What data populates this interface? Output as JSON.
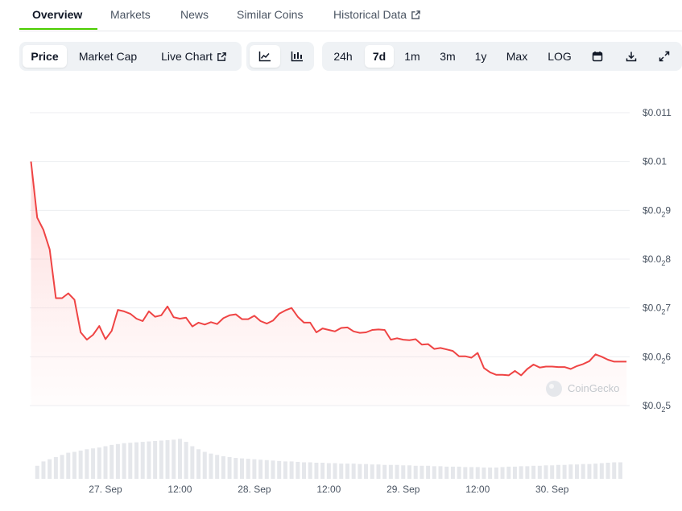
{
  "tabs": [
    {
      "label": "Overview",
      "active": true
    },
    {
      "label": "Markets"
    },
    {
      "label": "News"
    },
    {
      "label": "Similar Coins"
    },
    {
      "label": "Historical Data",
      "external": true
    }
  ],
  "toolbar": {
    "metric_buttons": [
      {
        "label": "Price",
        "active": true
      },
      {
        "label": "Market Cap"
      },
      {
        "label": "Live Chart",
        "external": true
      }
    ],
    "view_icons": [
      "line-chart-icon",
      "candlestick-chart-icon"
    ],
    "ranges": [
      {
        "label": "24h"
      },
      {
        "label": "7d",
        "active": true
      },
      {
        "label": "1m"
      },
      {
        "label": "3m"
      },
      {
        "label": "1y"
      },
      {
        "label": "Max"
      },
      {
        "label": "LOG"
      }
    ],
    "action_icons": [
      "calendar-icon",
      "download-icon",
      "fullscreen-icon"
    ]
  },
  "watermark": "CoinGecko",
  "colors": {
    "line": "#ef4444",
    "fill": "#fde2e2",
    "grid": "#eceef1",
    "volume": "#e5e7eb",
    "accent": "#4bcc00"
  },
  "chart_data": {
    "type": "line",
    "title": "",
    "xlabel": "",
    "ylabel": "",
    "x_ticks": [
      "27. Sep",
      "12:00",
      "28. Sep",
      "12:00",
      "29. Sep",
      "12:00",
      "30. Sep"
    ],
    "x_tick_hours": [
      12,
      24,
      36,
      48,
      60,
      72,
      84
    ],
    "y_ticks": [
      {
        "value": 0.011,
        "label": "$0.011"
      },
      {
        "value": 0.01,
        "label": "$0.01"
      },
      {
        "value": 0.009,
        "prefix": "$0.0",
        "sub": "2",
        "suffix": "9"
      },
      {
        "value": 0.008,
        "prefix": "$0.0",
        "sub": "2",
        "suffix": "8"
      },
      {
        "value": 0.007,
        "prefix": "$0.0",
        "sub": "2",
        "suffix": "7"
      },
      {
        "value": 0.006,
        "prefix": "$0.0",
        "sub": "2",
        "suffix": "6"
      },
      {
        "value": 0.005,
        "prefix": "$0.0",
        "sub": "2",
        "suffix": "5"
      }
    ],
    "ylim": [
      0.005,
      0.011
    ],
    "xlim_hours": [
      -0.2,
      96.5
    ],
    "grid": true,
    "series": [
      {
        "x_hours": [
          0,
          1,
          2,
          3,
          4,
          5,
          6,
          7,
          8,
          9,
          10,
          11,
          12,
          13,
          14,
          15,
          16,
          17,
          18,
          19,
          20,
          21,
          22,
          23,
          24,
          25,
          26,
          27,
          28,
          29,
          30,
          31,
          32,
          33,
          34,
          35,
          36,
          37,
          38,
          39,
          40,
          41,
          42,
          43,
          44,
          45,
          46,
          47,
          48,
          49,
          50,
          51,
          52,
          53,
          54,
          55,
          56,
          57,
          58,
          59,
          60,
          61,
          62,
          63,
          64,
          65,
          66,
          67,
          68,
          69,
          70,
          71,
          72,
          73,
          74,
          75,
          76,
          77,
          78,
          79,
          80,
          81,
          82,
          83,
          84,
          85,
          86,
          87,
          88,
          89,
          90,
          91,
          92,
          93,
          94,
          95,
          96
        ],
        "values": [
          0.01,
          0.00885,
          0.0086,
          0.0082,
          0.0072,
          0.0072,
          0.0073,
          0.00717,
          0.0065,
          0.00635,
          0.00645,
          0.00663,
          0.00636,
          0.00653,
          0.00696,
          0.00693,
          0.00688,
          0.00678,
          0.00673,
          0.00693,
          0.00682,
          0.00685,
          0.00703,
          0.00681,
          0.00678,
          0.0068,
          0.00662,
          0.0067,
          0.00666,
          0.00671,
          0.00667,
          0.00679,
          0.00685,
          0.00687,
          0.00677,
          0.00677,
          0.00684,
          0.00673,
          0.00668,
          0.00674,
          0.00688,
          0.00695,
          0.007,
          0.00682,
          0.0067,
          0.0067,
          0.0065,
          0.00658,
          0.00655,
          0.00652,
          0.00659,
          0.0066,
          0.00652,
          0.00649,
          0.0065,
          0.00655,
          0.00656,
          0.00655,
          0.00635,
          0.00638,
          0.00635,
          0.00634,
          0.00636,
          0.00625,
          0.00626,
          0.00616,
          0.00618,
          0.00615,
          0.00612,
          0.00601,
          0.00601,
          0.00598,
          0.00608,
          0.00577,
          0.00568,
          0.00563,
          0.00563,
          0.00562,
          0.00571,
          0.00562,
          0.00575,
          0.00584,
          0.00578,
          0.0058,
          0.0058,
          0.00579,
          0.00579,
          0.00575,
          0.00581,
          0.00585,
          0.00591,
          0.00605,
          0.006,
          0.00594,
          0.0059,
          0.0059,
          0.0059
        ]
      }
    ],
    "volume": {
      "x_hours": [
        1,
        2,
        3,
        4,
        5,
        6,
        7,
        8,
        9,
        10,
        11,
        12,
        13,
        14,
        15,
        16,
        17,
        18,
        19,
        20,
        21,
        22,
        23,
        24,
        25,
        26,
        27,
        28,
        29,
        30,
        31,
        32,
        33,
        34,
        35,
        36,
        37,
        38,
        39,
        40,
        41,
        42,
        43,
        44,
        45,
        46,
        47,
        48,
        49,
        50,
        51,
        52,
        53,
        54,
        55,
        56,
        57,
        58,
        59,
        60,
        61,
        62,
        63,
        64,
        65,
        66,
        67,
        68,
        69,
        70,
        71,
        72,
        73,
        74,
        75,
        76,
        77,
        78,
        79,
        80,
        81,
        82,
        83,
        84,
        85,
        86,
        87,
        88,
        89,
        90,
        91,
        92,
        93,
        94,
        95
      ],
      "values": [
        0.3,
        0.4,
        0.45,
        0.5,
        0.55,
        0.6,
        0.62,
        0.65,
        0.68,
        0.7,
        0.72,
        0.75,
        0.78,
        0.8,
        0.82,
        0.83,
        0.84,
        0.85,
        0.86,
        0.87,
        0.88,
        0.89,
        0.9,
        0.92,
        0.85,
        0.75,
        0.68,
        0.62,
        0.58,
        0.55,
        0.52,
        0.5,
        0.48,
        0.47,
        0.46,
        0.45,
        0.44,
        0.43,
        0.42,
        0.41,
        0.4,
        0.4,
        0.39,
        0.38,
        0.38,
        0.37,
        0.37,
        0.36,
        0.36,
        0.35,
        0.35,
        0.35,
        0.34,
        0.34,
        0.33,
        0.33,
        0.32,
        0.32,
        0.32,
        0.31,
        0.31,
        0.3,
        0.3,
        0.3,
        0.29,
        0.29,
        0.28,
        0.28,
        0.28,
        0.27,
        0.27,
        0.27,
        0.26,
        0.26,
        0.26,
        0.27,
        0.28,
        0.28,
        0.29,
        0.29,
        0.3,
        0.3,
        0.31,
        0.31,
        0.32,
        0.32,
        0.33,
        0.33,
        0.34,
        0.34,
        0.35,
        0.36,
        0.37,
        0.38,
        0.38
      ]
    }
  }
}
